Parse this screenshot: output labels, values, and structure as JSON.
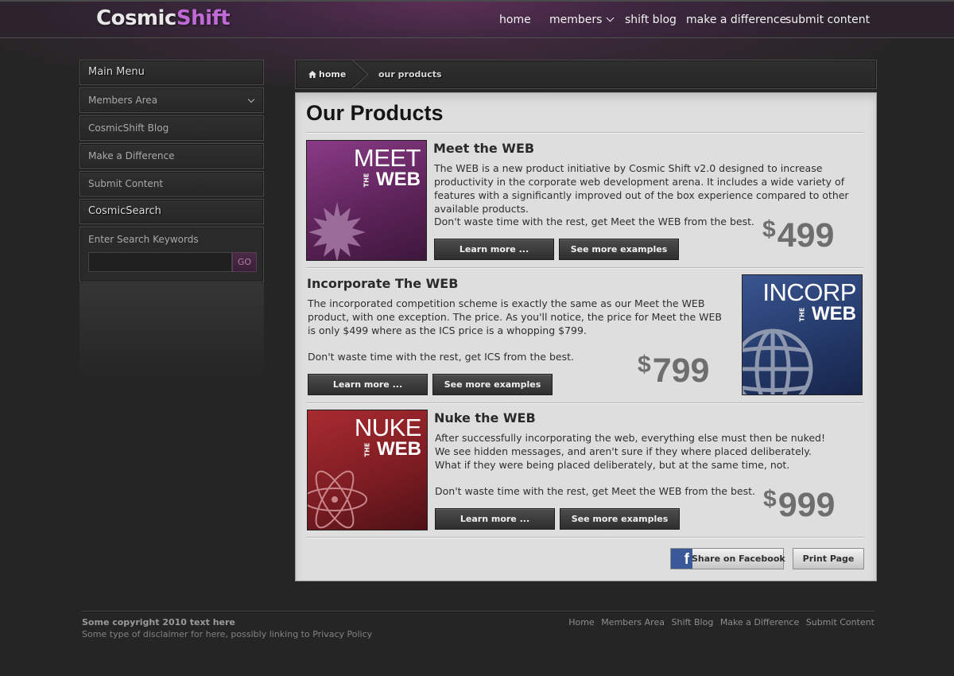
{
  "brand": {
    "part1": "Cosmic",
    "part2": "Shift",
    "accent": "#c06ad8"
  },
  "topnav": {
    "home": "home",
    "members": "members",
    "blog": "shift blog",
    "difference": "make a difference",
    "submit": "submit content"
  },
  "sidebar": {
    "main_menu": "Main Menu",
    "members_area": "Members Area",
    "blog": "CosmicShift Blog",
    "difference": "Make a Difference",
    "submit": "Submit Content",
    "search_heading": "CosmicSearch",
    "search_label": "Enter Search Keywords",
    "search_value": "",
    "search_go": "GO"
  },
  "breadcrumb": {
    "home": "home",
    "current": "our products"
  },
  "page": {
    "title": "Our Products"
  },
  "products": [
    {
      "name": "Meet the WEB",
      "thumb": {
        "big": "MEET",
        "the": "THE",
        "web": "WEB",
        "color": "#6a2a68",
        "icon": "starburst-icon"
      },
      "description": "The WEB is a new product initiative by Cosmic Shift v2.0 designed to increase productivity in the corporate web development arena.  It includes a wide variety of features with a significantly improved out of the box experience compared to other available products.",
      "tagline": "Don't waste time with the rest, get Meet the WEB from the best.",
      "currency": "$",
      "price": "499",
      "learn": "Learn more ...",
      "examples": "See more examples"
    },
    {
      "name": "Incorporate The WEB",
      "thumb": {
        "big": "INCORP",
        "the": "THE",
        "web": "WEB",
        "color": "#23375e",
        "icon": "globe-icon"
      },
      "description": "The incorporated competition scheme is exactly the same as our Meet the WEB product, with one exception.  The price.  As you'll notice, the price for Meet the WEB is only $499 where as the ICS price is a whopping $799.",
      "tagline": "Don't waste time with the rest, get ICS from the best.",
      "currency": "$",
      "price": "799",
      "learn": "Learn more ...",
      "examples": "See more examples"
    },
    {
      "name": "Nuke the WEB",
      "thumb": {
        "big": "NUKE",
        "the": "THE",
        "web": "WEB",
        "color": "#7d1d22",
        "icon": "atom-icon"
      },
      "description": "After successfully incorporating the web, everything else must then be nuked!  We see hidden messages, and aren't sure if they where placed deliberately.  What if they were being placed deliberately, but at the same time, not.",
      "tagline": "Don't waste time with the rest, get Meet the WEB from the best.",
      "currency": "$",
      "price": "999",
      "learn": "Learn more ...",
      "examples": "See more examples"
    }
  ],
  "actions": {
    "facebook_icon": "f",
    "share": "Share on Facebook",
    "print": "Print Page"
  },
  "footer": {
    "copyright": "Some copyright 2010 text here",
    "disclaimer": "Some type of disclaimer for here, possibly linking to Privacy Policy",
    "links": [
      "Home",
      "Members Area",
      "Shift Blog",
      "Make a Difference",
      "Submit Content"
    ]
  }
}
